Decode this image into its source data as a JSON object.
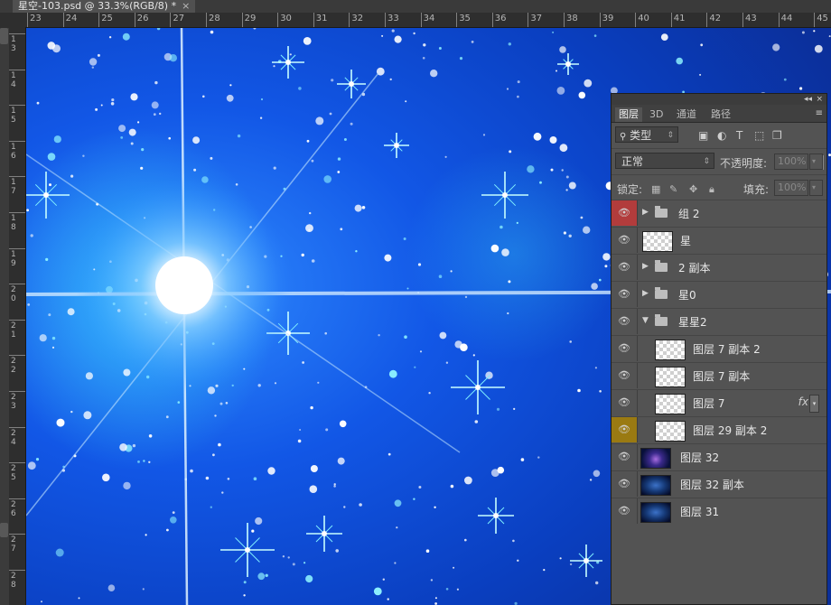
{
  "document": {
    "tab_title": "星空-103.psd @ 33.3%(RGB/8) *",
    "close_glyph": "×"
  },
  "ruler_top": {
    "labels": [
      "23",
      "24",
      "25",
      "26",
      "27",
      "28",
      "29",
      "30",
      "31",
      "32",
      "33",
      "34",
      "35",
      "36",
      "37",
      "38",
      "39",
      "40",
      "41",
      "42",
      "43",
      "44",
      "45"
    ]
  },
  "ruler_left": {
    "labels": [
      "1\n3",
      "1\n4",
      "1\n5",
      "1\n6",
      "1\n7",
      "1\n8",
      "1\n9",
      "2\n0",
      "2\n1",
      "2\n2",
      "2\n3",
      "2\n4",
      "2\n5",
      "2\n6",
      "2\n7",
      "2\n8"
    ]
  },
  "layers_panel": {
    "collapse_glyph": "◂◂",
    "close_glyph": "×",
    "tabs": [
      {
        "label": "图层",
        "active": true
      },
      {
        "label": "3D",
        "active": false
      },
      {
        "label": "通道",
        "active": false
      },
      {
        "label": "路径",
        "active": false
      }
    ],
    "menu_glyph": "≡",
    "filter": {
      "kind_label": "类型",
      "search_icon": "magnifier-icon"
    },
    "blend_mode": "正常",
    "opacity_label": "不透明度:",
    "opacity_value": "100%",
    "lock_label": "锁定:",
    "fill_label": "填充:",
    "fill_value": "100%",
    "layers": [
      {
        "name": "组 2",
        "type": "group",
        "expanded": false,
        "indent": 0,
        "eye": "red"
      },
      {
        "name": "星",
        "type": "layer",
        "indent": 0,
        "eye": "normal"
      },
      {
        "name": "2 副本",
        "type": "group",
        "expanded": false,
        "indent": 0,
        "eye": "normal"
      },
      {
        "name": "星0",
        "type": "group",
        "expanded": false,
        "indent": 0,
        "eye": "normal"
      },
      {
        "name": "星星2",
        "type": "group",
        "expanded": true,
        "indent": 0,
        "eye": "normal"
      },
      {
        "name": "图层 7 副本 2",
        "type": "layer",
        "indent": 1,
        "eye": "normal"
      },
      {
        "name": "图层 7 副本",
        "type": "layer",
        "indent": 1,
        "eye": "normal"
      },
      {
        "name": "图层 7",
        "type": "layer",
        "indent": 1,
        "eye": "normal",
        "fx": "fx"
      },
      {
        "name": "图层 29 副本 2",
        "type": "layer",
        "indent": 1,
        "eye": "yellow"
      },
      {
        "name": "图层 32",
        "type": "image",
        "indent": 0,
        "eye": "normal"
      },
      {
        "name": "图层 32 副本",
        "type": "image2",
        "indent": 0,
        "eye": "normal"
      },
      {
        "name": "图层 31",
        "type": "image2",
        "indent": 0,
        "eye": "normal"
      }
    ]
  }
}
